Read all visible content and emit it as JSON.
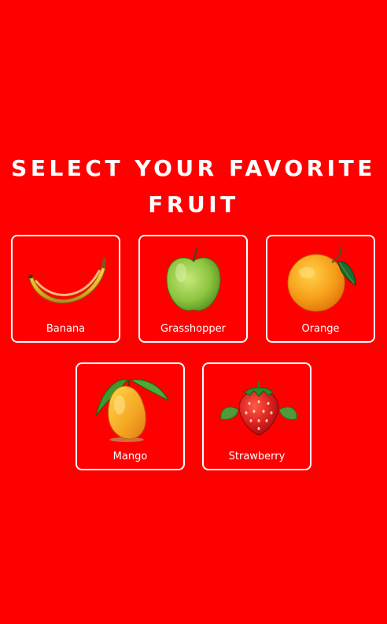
{
  "page": {
    "title": "SELECT YOUR FAVORITE FRUIT",
    "background_color": "#ff0000"
  },
  "fruits": [
    {
      "label": "Banana",
      "icon": "banana-icon"
    },
    {
      "label": "Grasshopper",
      "icon": "green-apple-icon"
    },
    {
      "label": "Orange",
      "icon": "orange-icon"
    },
    {
      "label": "Mango",
      "icon": "mango-icon"
    },
    {
      "label": "Strawberry",
      "icon": "strawberry-icon"
    }
  ]
}
